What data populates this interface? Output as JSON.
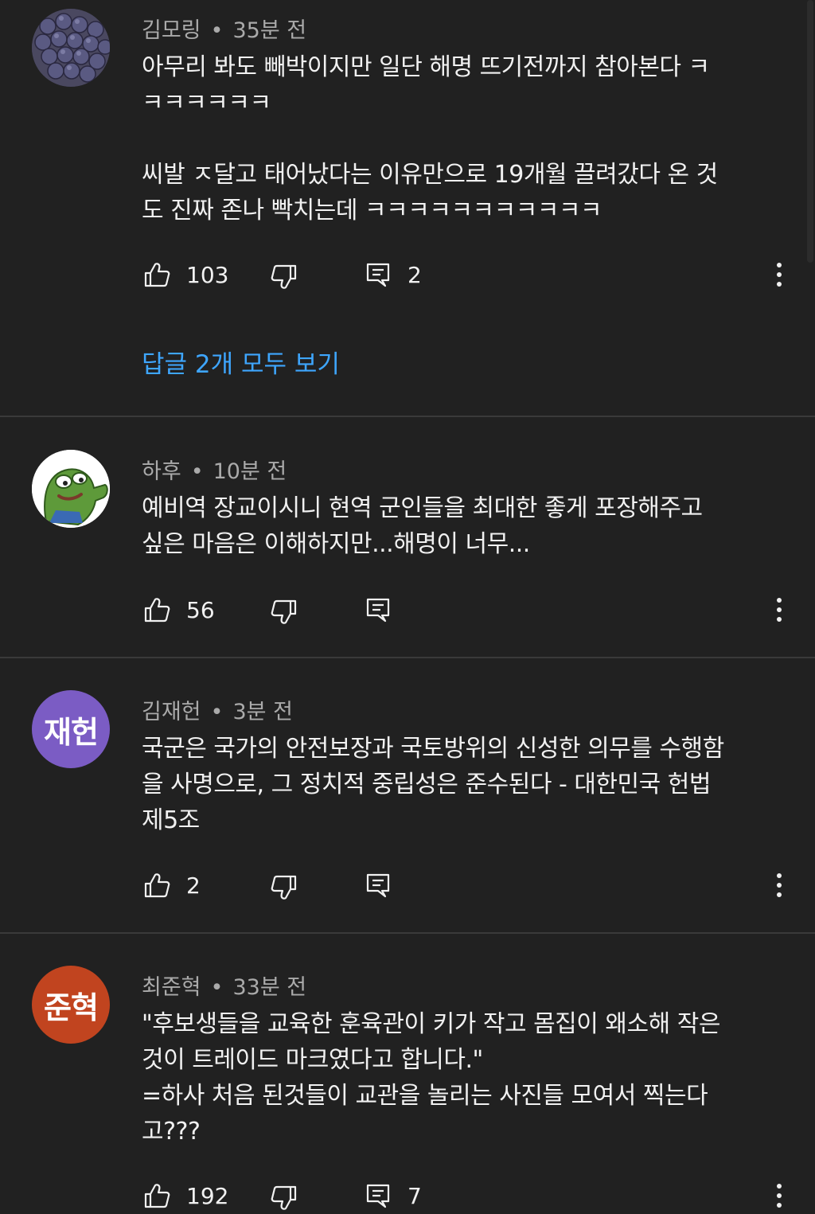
{
  "comments": [
    {
      "author": "김모링",
      "time": "35분 전",
      "text": "아무리 봐도 빼박이지만 일단 해명 뜨기전까지 참아본다 ㅋ\nㅋㅋㅋㅋㅋㅋ\n\n씨발 ㅈ달고 태어났다는 이유만으로 19개월 끌려갔다 온 것\n도 진짜 존나 빡치는데 ㅋㅋㅋㅋㅋㅋㅋㅋㅋㅋㅋ",
      "likes": "103",
      "replies_count": "2",
      "view_replies": "답글 2개 모두 보기",
      "avatar": "grapes-photo"
    },
    {
      "author": "하후",
      "time": "10분 전",
      "text": "예비역 장교이시니 현역 군인들을 최대한 좋게 포장해주고\n싶은 마음은 이해하지만...해명이 너무...",
      "likes": "56",
      "avatar": "pepe-frog-image"
    },
    {
      "author": "김재헌",
      "time": "3분 전",
      "text": "국군은 국가의 안전보장과 국토방위의 신성한 의무를 수행함\n을 사명으로, 그 정치적 중립성은 준수된다 - 대한민국 헌법\n제5조",
      "likes": "2",
      "avatar_initials": "재헌",
      "avatar_color": "#7b5cc4"
    },
    {
      "author": "최준혁",
      "time": "33분 전",
      "text": "\"후보생들을 교육한 훈육관이 키가 작고 몸집이 왜소해 작은\n것이 트레이드 마크였다고 합니다.\"\n=하사 처음 된것들이 교관을 놀리는 사진들 모여서 찍는다\n고???",
      "likes": "192",
      "replies_count": "7",
      "avatar_initials": "준혁",
      "avatar_color": "#c1441f"
    }
  ],
  "colors": {
    "background": "#212121",
    "link": "#3ea6ff",
    "meta": "#aaaaaa"
  },
  "icons": [
    "thumbs-up-icon",
    "thumbs-down-icon",
    "reply-icon",
    "more-vert-icon"
  ]
}
